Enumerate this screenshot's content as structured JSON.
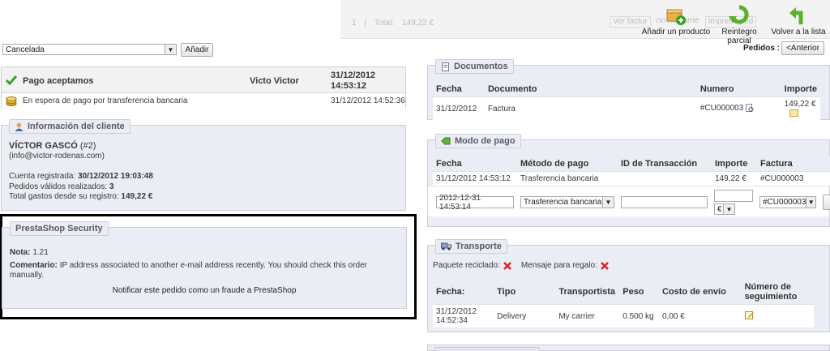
{
  "toolbar": {
    "ghost_text": [
      "1",
      "|",
      "Total:",
      "149,22 €"
    ],
    "ghost_buttons": [
      "Ver factur",
      "no hay arrie",
      "Imprimir ped"
    ],
    "add_product": "Añadir un producto",
    "partial_refund": "Reintegro parcial",
    "back_to_list": "Volver a la lista"
  },
  "orders_nav": {
    "label": "Pedidos :",
    "prev_button": "<Anterior"
  },
  "status_form": {
    "selected_status": "Cancelada",
    "add_button": "Añadir"
  },
  "status_history": [
    {
      "icon": "check-icon",
      "status": "Pago aceptamos",
      "employee": "Victo Victor",
      "date": "31/12/2012",
      "time": "14:53:12"
    },
    {
      "icon": "coins-icon",
      "status": "En espera de pago por transferencia bancaria",
      "employee": "",
      "date": "31/12/2012 14:52:36",
      "time": ""
    }
  ],
  "customer": {
    "legend": "Información del cliente",
    "name": "VÍCTOR GASCÓ",
    "id": "(#2)",
    "email": "(info@victor-rodenas.com)",
    "registered_label": "Cuenta registrada:",
    "registered_value": "30/12/2012 19:03:48",
    "valid_orders_label": "Pedidos válidos realizados:",
    "valid_orders_value": "3",
    "total_spent_label": "Total gastos desde su registro:",
    "total_spent_value": "149,22 €"
  },
  "security": {
    "legend": "PrestaShop Security",
    "note_label": "Nota:",
    "note_value": "1.21",
    "comment_label": "Comentario:",
    "comment_value": "IP address associated to another e-mail address recently. You should check this order manually.",
    "fraud_link": "Notificar este pedido como un fraude a PrestaShop"
  },
  "documents": {
    "legend": "Documentos",
    "headers": [
      "Fecha",
      "Documento",
      "Numero",
      "Importe"
    ],
    "rows": [
      {
        "date": "31/12/2012",
        "doc": "Factura",
        "number": "#CU000003",
        "amount": "149,22 €"
      }
    ]
  },
  "payment": {
    "legend": "Modo de pago",
    "headers": [
      "Fecha",
      "Método de pago",
      "ID de Transacción",
      "Importe",
      "Factura"
    ],
    "rows": [
      {
        "date": "31/12/2012 14:53:12",
        "method": "Trasferencia bancaria",
        "transaction": "",
        "amount": "149,22 €",
        "invoice": "#CU000003"
      }
    ],
    "form": {
      "date": "2012-12-31 14:53:14",
      "method": "Trasferencia bancaria",
      "transaction": "",
      "amount": "",
      "currency": "€",
      "invoice": "#CU000003"
    }
  },
  "shipping": {
    "legend": "Transporte",
    "recycled_label": "Paquete reciclado:",
    "gift_label": "Mensaje para regalo:",
    "headers": [
      "Fecha:",
      "Tipo",
      "Transportista",
      "Peso",
      "Costo de envío",
      "Número de seguimiento"
    ],
    "rows": [
      {
        "date": "31/12/2012 14:52:34",
        "type": "Delivery",
        "carrier": "My carrier",
        "weight": "0.500 kg",
        "cost": "0,00 €"
      }
    ]
  },
  "colors": {
    "panel_bg": "#ebedf4",
    "panel_border": "#ccced7",
    "frame": "#000000",
    "red_x": "#e02020",
    "green": "#3aa020"
  }
}
